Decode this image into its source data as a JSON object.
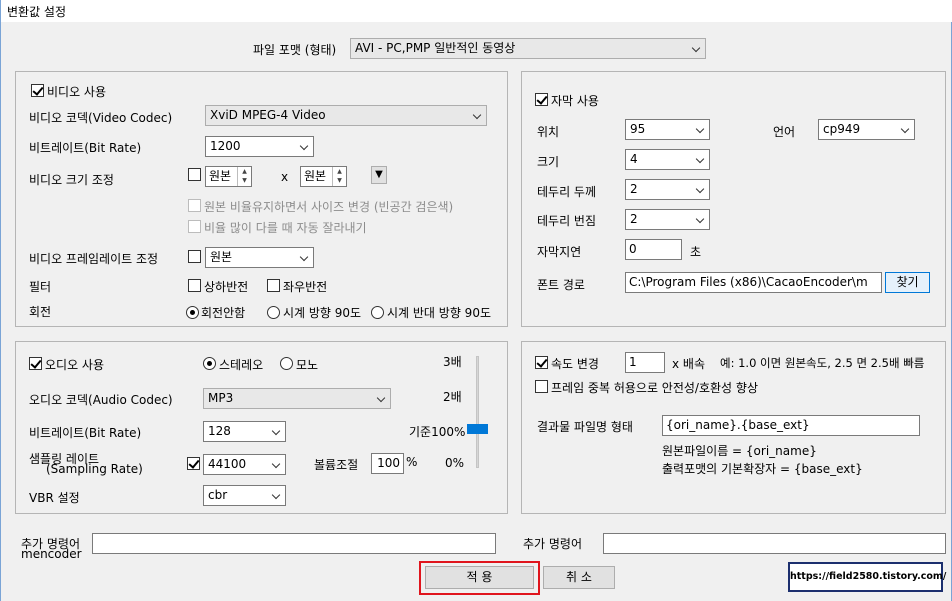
{
  "window": {
    "title": "변환값 설정"
  },
  "format": {
    "label": "파일 포맷 (형태)",
    "value": "AVI - PC,PMP 일반적인 동영상"
  },
  "video": {
    "use_label": "비디오 사용",
    "use_checked": true,
    "codec_label": "비디오 코덱(Video Codec)",
    "codec_value": "XviD MPEG-4 Video",
    "bitrate_label": "비트레이트(Bit Rate)",
    "bitrate_value": "1200",
    "size_label": "비디오 크기 조정",
    "width_value": "원본",
    "times_sign": "x",
    "height_value": "원본",
    "keep_ratio_label": "원본 비율유지하면서 사이즈 변경 (빈공간 검은색)",
    "auto_crop_label": "비율 많이 다를 때 자동 잘라내기",
    "framerate_label": "비디오 프레임레이트 조정",
    "framerate_value": "원본",
    "filter_label": "필터",
    "flip_v_label": "상하반전",
    "flip_h_label": "좌우반전",
    "rotate_label": "회전",
    "rotate_none": "회전안함",
    "rotate_cw": "시계 방향 90도",
    "rotate_ccw": "시계 반대 방향 90도"
  },
  "subtitle": {
    "use_label": "자막 사용",
    "use_checked": true,
    "position_label": "위치",
    "position_value": "95",
    "lang_label": "언어",
    "lang_value": "cp949",
    "size_label": "크기",
    "size_value": "4",
    "border_label": "테두리 두께",
    "border_value": "2",
    "blur_label": "테두리 번짐",
    "blur_value": "2",
    "delay_label": "자막지연",
    "delay_value": "0",
    "delay_unit": "초",
    "font_label": "폰트 경로",
    "font_value": "C:\\Program Files (x86)\\CacaoEncoder\\m",
    "find_button": "찾기"
  },
  "audio": {
    "use_label": "오디오 사용",
    "use_checked": true,
    "stereo_label": "스테레오",
    "mono_label": "모노",
    "codec_label": "오디오 코덱(Audio Codec)",
    "codec_value": "MP3",
    "bitrate_label": "비트레이트(Bit Rate)",
    "bitrate_value": "128",
    "samplerate_label_1": "샘플링 레이트",
    "samplerate_label_2": "(Sampling Rate)",
    "samplerate_value": "44100",
    "volume_label": "볼륨조절",
    "volume_value": "100",
    "volume_unit": "%",
    "vbr_label": "VBR 설정",
    "vbr_value": "cbr",
    "gain_3x": "3배",
    "gain_2x": "2배",
    "gain_base": "기준100%",
    "gain_0": "0%"
  },
  "speed": {
    "change_label": "속도 변경",
    "change_checked": true,
    "speed_value": "1",
    "times_label": "x 배속",
    "example": "예: 1.0 이면 원본속도, 2.5 면 2.5배 빠름",
    "dup_frame_label": "프레임 중복 허용으로 안전성/호환성 향상",
    "output_label": "결과물 파일명 형태",
    "output_value": "{ori_name}.{base_ext}",
    "note_1": "원본파일이름 = {ori_name}",
    "note_2": "출력포맷의 기본확장자 = {base_ext}"
  },
  "extra": {
    "left_label_1": "추가 명령어",
    "left_label_2": "mencoder",
    "left_value": "",
    "right_label": "추가 명령어",
    "right_value": ""
  },
  "buttons": {
    "apply": "적 용",
    "cancel": "취 소"
  },
  "watermark": "https://field2580.tistory.com/"
}
